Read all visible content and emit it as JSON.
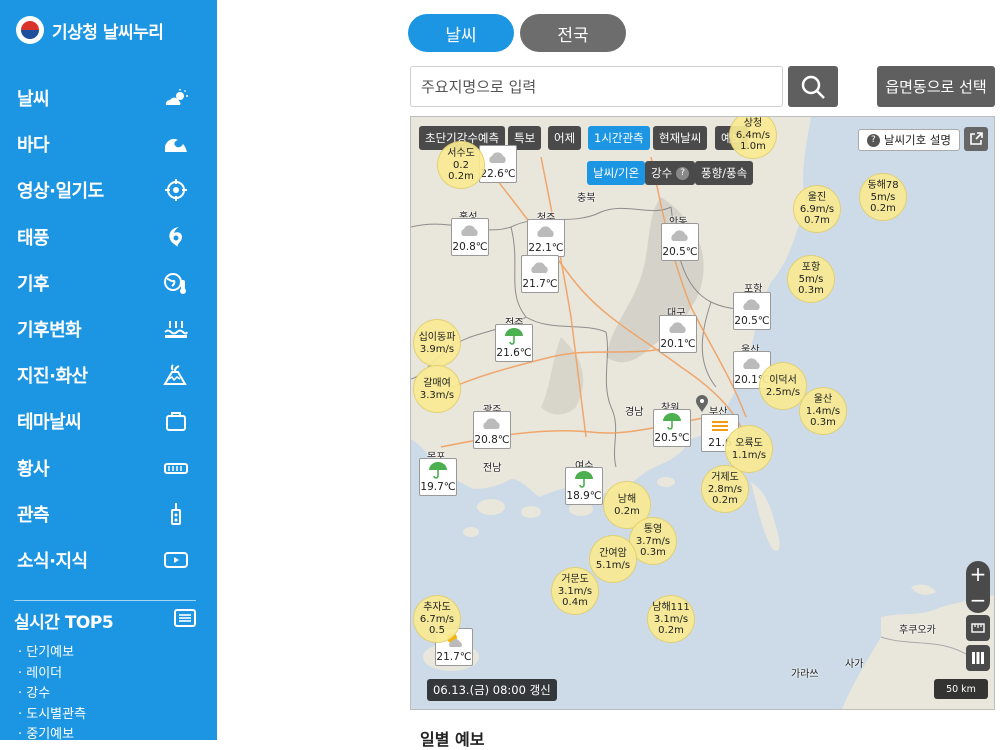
{
  "brand": {
    "title": "기상청 날씨누리"
  },
  "menu": [
    {
      "label": "날씨",
      "icon": "sun-cloud-icon"
    },
    {
      "label": "바다",
      "icon": "wave-icon"
    },
    {
      "label": "영상·일기도",
      "icon": "target-icon"
    },
    {
      "label": "태풍",
      "icon": "typhoon-icon"
    },
    {
      "label": "기후",
      "icon": "globe-thermometer-icon"
    },
    {
      "label": "기후변화",
      "icon": "rising-water-icon"
    },
    {
      "label": "지진·화산",
      "icon": "volcano-icon"
    },
    {
      "label": "테마날씨",
      "icon": "suitcase-icon"
    },
    {
      "label": "황사",
      "icon": "dust-icon"
    },
    {
      "label": "관측",
      "icon": "observation-tower-icon"
    },
    {
      "label": "소식·지식",
      "icon": "play-icon"
    }
  ],
  "top5": {
    "title": "실시간 TOP5",
    "items": [
      "단기예보",
      "레이더",
      "강수",
      "도시별관측",
      "중기예보"
    ]
  },
  "tabs": {
    "weather": "날씨",
    "national": "전국"
  },
  "search": {
    "placeholder": "주요지명으로 입력",
    "region_button": "읍면동으로 선택"
  },
  "map": {
    "filters": [
      "초단기강수예측",
      "특보",
      "어제",
      "1시간관측",
      "현재날씨",
      "예보"
    ],
    "active_filter": "1시간관측",
    "sub_filters": [
      "날씨/기온",
      "강수",
      "풍향/풍속"
    ],
    "active_sub_filter": "날씨/기온",
    "legend_button": "날씨기호 설명",
    "timestamp": "06.13.(금) 08:00 갱신",
    "scale": "50 km",
    "markers": [
      {
        "temp": "22.6℃",
        "icon": "cloud"
      },
      {
        "city": "홍성",
        "temp": "20.8℃",
        "icon": "cloud"
      },
      {
        "city": "청주",
        "temp": "22.1℃",
        "icon": "cloud"
      },
      {
        "temp": "21.7℃",
        "icon": "cloud"
      },
      {
        "city": "안동",
        "temp": "20.5℃",
        "icon": "cloud"
      },
      {
        "city": "대구",
        "temp": "20.1℃",
        "icon": "cloud"
      },
      {
        "city": "포항",
        "temp": "20.5℃",
        "icon": "cloud"
      },
      {
        "city": "울산",
        "temp": "20.1℃",
        "icon": "cloud"
      },
      {
        "city": "전주",
        "temp": "21.6℃",
        "icon": "umbrella"
      },
      {
        "city": "광주",
        "temp": "20.8℃",
        "icon": "cloud"
      },
      {
        "city": "목포",
        "temp": "19.7℃",
        "icon": "umbrella"
      },
      {
        "city": "여수",
        "temp": "18.9℃",
        "icon": "umbrella"
      },
      {
        "city": "창원",
        "temp": "20.5℃",
        "icon": "umbrella"
      },
      {
        "city": "부산",
        "temp": "21.6",
        "icon": "fog"
      },
      {
        "temp": "21.7℃",
        "icon": "sun-cloud"
      }
    ],
    "bubbles": [
      {
        "name": "서수도",
        "l1": "0.2",
        "l2": "0.2m"
      },
      {
        "name": "울진",
        "l1": "6.9m/s",
        "l2": "0.7m"
      },
      {
        "name": "동해78",
        "l1": "5m/s",
        "l2": "0.2m"
      },
      {
        "name": "포항",
        "l1": "5m/s",
        "l2": "0.3m"
      },
      {
        "name": "십이동파",
        "l1": "3.9m/s",
        "l2": ""
      },
      {
        "name": "갈매여",
        "l1": "3.3m/s",
        "l2": ""
      },
      {
        "name": "이덕서",
        "l1": "2.5m/s",
        "l2": ""
      },
      {
        "name": "울산",
        "l1": "1.4m/s",
        "l2": "0.3m"
      },
      {
        "name": "오륙도",
        "l1": "1.1m/s",
        "l2": ""
      },
      {
        "name": "거제도",
        "l1": "2.8m/s",
        "l2": "0.2m"
      },
      {
        "name": "남해",
        "l1": "0.2m",
        "l2": ""
      },
      {
        "name": "통영",
        "l1": "3.7m/s",
        "l2": "0.3m"
      },
      {
        "name": "간여암",
        "l1": "5.1m/s",
        "l2": ""
      },
      {
        "name": "거문도",
        "l1": "3.1m/s",
        "l2": "0.4m"
      },
      {
        "name": "남해111",
        "l1": "3.1m/s",
        "l2": "0.2m"
      },
      {
        "name": "추자도",
        "l1": "6.7m/s",
        "l2": "0.5"
      },
      {
        "name": "상청",
        "l1": "6.4m/s",
        "l2": "1.0m"
      }
    ],
    "city_labels": [
      "충북",
      "경남",
      "전남",
      "후쿠오카",
      "사가",
      "가라쓰"
    ]
  },
  "section": {
    "title": "일별 예보"
  }
}
